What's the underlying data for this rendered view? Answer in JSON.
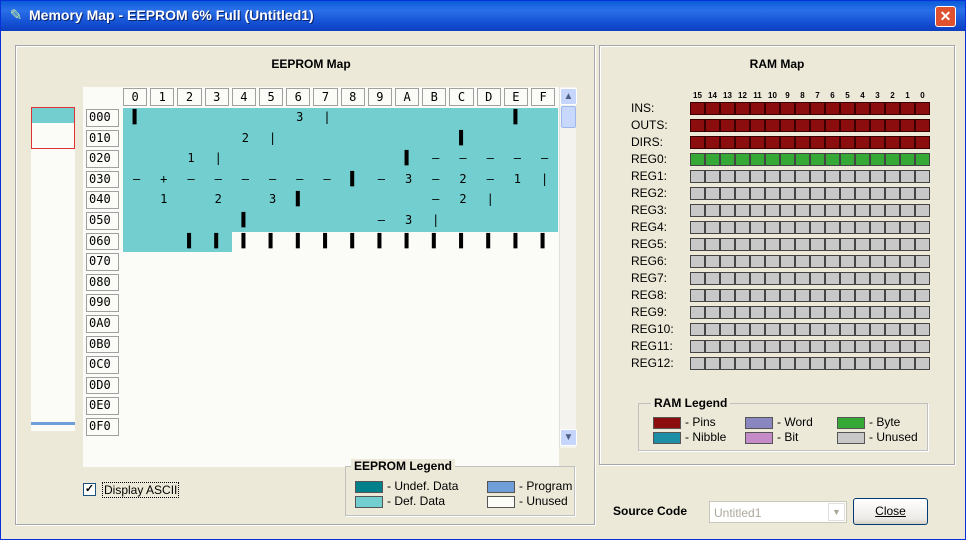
{
  "window": {
    "title": "Memory Map - EEPROM 6% Full (Untitled1)",
    "title_icon": "chip-icon"
  },
  "eeprom": {
    "title": "EEPROM Map",
    "columns": [
      "0",
      "1",
      "2",
      "3",
      "4",
      "5",
      "6",
      "7",
      "8",
      "9",
      "A",
      "B",
      "C",
      "D",
      "E",
      "F"
    ],
    "rows": [
      "000",
      "010",
      "020",
      "030",
      "040",
      "050",
      "060",
      "070",
      "080",
      "090",
      "0A0",
      "0B0",
      "0C0",
      "0D0",
      "0E0",
      "0F0"
    ],
    "filled_rows": 6,
    "partial_row_columns": 4,
    "cells": [
      [
        "▌",
        "",
        "",
        "",
        "",
        "",
        "3",
        "|",
        "",
        "",
        "",
        "",
        "",
        "",
        "▌",
        ""
      ],
      [
        "",
        "",
        "",
        "",
        "2",
        "|",
        "",
        "",
        "",
        "",
        "",
        "",
        "▌",
        "",
        "",
        ""
      ],
      [
        "",
        "",
        "1",
        "|",
        "",
        "",
        "",
        "",
        "",
        "",
        "▌",
        "–",
        "–",
        "–",
        "–",
        "–"
      ],
      [
        "–",
        "+",
        "–",
        "–",
        "–",
        "–",
        "–",
        "–",
        "▌",
        "–",
        "3",
        "–",
        "2",
        "–",
        "1",
        "|"
      ],
      [
        "",
        "1",
        "",
        "2",
        "",
        "3",
        "▌",
        "",
        "",
        "",
        "",
        "–",
        "2",
        "|",
        "",
        ""
      ],
      [
        "",
        "",
        "",
        "",
        "▌",
        "",
        "",
        "",
        "",
        "–",
        "3",
        "|",
        "",
        "",
        "",
        ""
      ],
      [
        "",
        "",
        "▌",
        "▌",
        "▌",
        "▌",
        "▌",
        "▌",
        "▌",
        "▌",
        "▌",
        "▌",
        "▌",
        "▌",
        "▌",
        "▌"
      ]
    ],
    "display_ascii_label": "Display ASCII",
    "display_ascii_checked": true,
    "legend": {
      "title": "EEPROM Legend",
      "items": [
        {
          "label": "- Undef. Data",
          "color": "#00808a"
        },
        {
          "label": "- Program",
          "color": "#6f9ed8"
        },
        {
          "label": "- Def. Data",
          "color": "#72cecf"
        },
        {
          "label": "- Unused",
          "color": "#fbfbf7"
        }
      ]
    }
  },
  "ram": {
    "title": "RAM Map",
    "bit_headers": [
      "15",
      "14",
      "13",
      "12",
      "11",
      "10",
      "9",
      "8",
      "7",
      "6",
      "5",
      "4",
      "3",
      "2",
      "1",
      "0"
    ],
    "rows": [
      {
        "label": "INS:",
        "type": "pins"
      },
      {
        "label": "OUTS:",
        "type": "pins"
      },
      {
        "label": "DIRS:",
        "type": "pins"
      },
      {
        "label": "REG0:",
        "type": "byte"
      },
      {
        "label": "REG1:",
        "type": "unused"
      },
      {
        "label": "REG2:",
        "type": "unused"
      },
      {
        "label": "REG3:",
        "type": "unused"
      },
      {
        "label": "REG4:",
        "type": "unused"
      },
      {
        "label": "REG5:",
        "type": "unused"
      },
      {
        "label": "REG6:",
        "type": "unused"
      },
      {
        "label": "REG7:",
        "type": "unused"
      },
      {
        "label": "REG8:",
        "type": "unused"
      },
      {
        "label": "REG9:",
        "type": "unused"
      },
      {
        "label": "REG10:",
        "type": "unused"
      },
      {
        "label": "REG11:",
        "type": "unused"
      },
      {
        "label": "REG12:",
        "type": "unused"
      }
    ],
    "colors": {
      "pins": "#8b0d0d",
      "byte": "#35a835",
      "unused": "#c8c8c8"
    },
    "legend": {
      "title": "RAM Legend",
      "items": [
        {
          "label": "- Pins",
          "color": "#8b0d0d"
        },
        {
          "label": "- Word",
          "color": "#8a87c0"
        },
        {
          "label": "- Byte",
          "color": "#35a835"
        },
        {
          "label": "- Nibble",
          "color": "#1d8ea6"
        },
        {
          "label": "- Bit",
          "color": "#c58bc8"
        },
        {
          "label": "- Unused",
          "color": "#c8c8c8"
        }
      ]
    }
  },
  "footer": {
    "source_code_label": "Source Code",
    "source_code_value": "Untitled1",
    "close_label": "Close"
  }
}
